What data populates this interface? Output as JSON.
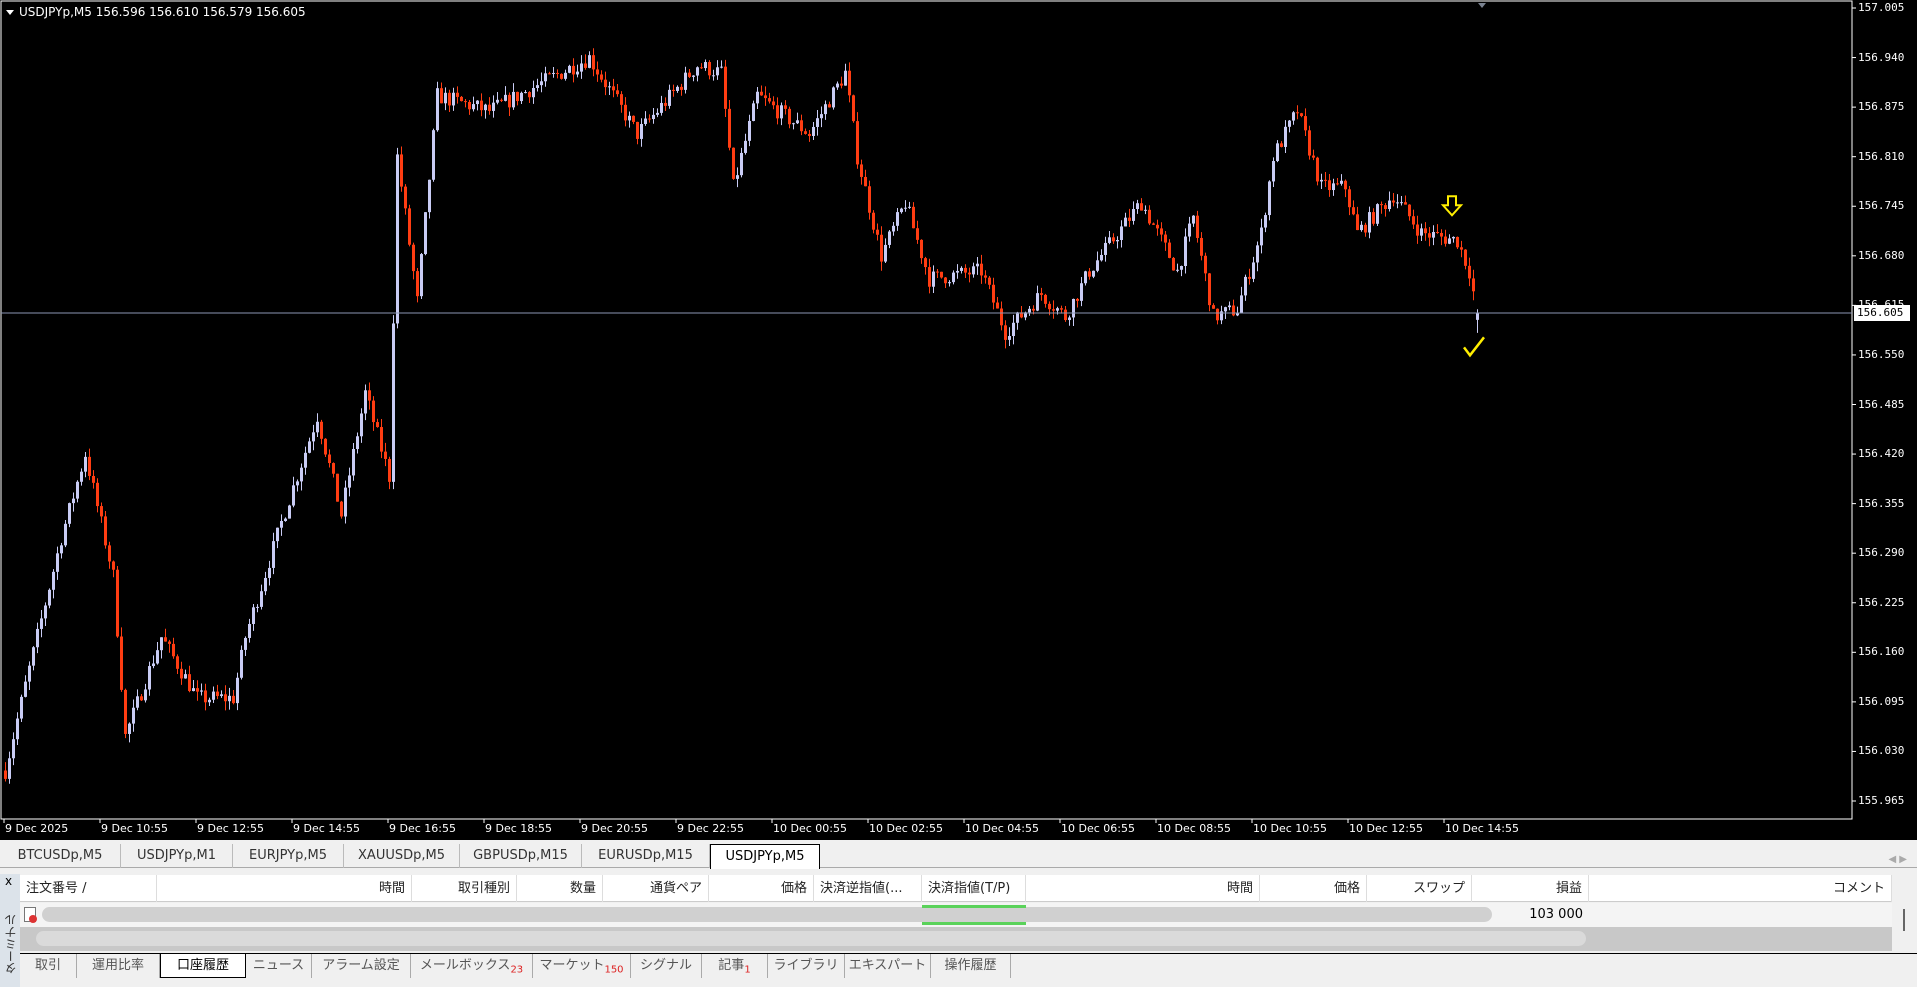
{
  "chart": {
    "symbol_line": "USDJPYp,M5  156.596 156.610 156.579 156.605",
    "bid_label": "156.605",
    "colors": {
      "bull": "#c9ccf5",
      "bear": "#ff3d12",
      "bid_line": "#8c96b4",
      "annotation": "#ffee00"
    }
  },
  "chart_data": {
    "type": "candlestick",
    "timeframe": "M5",
    "y_ticks": [
      "157.005",
      "156.940",
      "156.875",
      "156.810",
      "156.745",
      "156.680",
      "156.615",
      "156.550",
      "156.485",
      "156.420",
      "156.355",
      "156.290",
      "156.225",
      "156.160",
      "156.095",
      "156.030",
      "155.965"
    ],
    "ylim": [
      155.965,
      157.005
    ],
    "x_ticks": [
      "9 Dec 2025",
      "9 Dec 10:55",
      "9 Dec 12:55",
      "9 Dec 14:55",
      "9 Dec 16:55",
      "9 Dec 18:55",
      "9 Dec 20:55",
      "9 Dec 22:55",
      "10 Dec 00:55",
      "10 Dec 02:55",
      "10 Dec 04:55",
      "10 Dec 06:55",
      "10 Dec 08:55",
      "10 Dec 10:55",
      "10 Dec 12:55",
      "10 Dec 14:55"
    ],
    "last": {
      "open": 156.596,
      "high": 156.61,
      "low": 156.579,
      "close": 156.605
    },
    "approx_close_path": [
      [
        "2025-12-09 08:55",
        156.005
      ],
      [
        "2025-12-09 09:20",
        156.117
      ],
      [
        "2025-12-09 10:05",
        156.31
      ],
      [
        "2025-12-09 10:35",
        156.42
      ],
      [
        "2025-12-09 11:10",
        156.26
      ],
      [
        "2025-12-09 11:25",
        156.05
      ],
      [
        "2025-12-09 12:10",
        156.18
      ],
      [
        "2025-12-09 12:55",
        156.1
      ],
      [
        "2025-12-09 13:40",
        156.1
      ],
      [
        "2025-12-09 13:55",
        156.18
      ],
      [
        "2025-12-09 14:40",
        156.33
      ],
      [
        "2025-12-09 15:25",
        156.47
      ],
      [
        "2025-12-09 15:55",
        156.34
      ],
      [
        "2025-12-09 16:25",
        156.5
      ],
      [
        "2025-12-09 16:55",
        156.39
      ],
      [
        "2025-12-09 17:05",
        156.81
      ],
      [
        "2025-12-09 17:30",
        156.62
      ],
      [
        "2025-12-09 17:55",
        156.89
      ],
      [
        "2025-12-09 19:00",
        156.87
      ],
      [
        "2025-12-09 21:05",
        156.94
      ],
      [
        "2025-12-09 22:05",
        156.84
      ],
      [
        "2025-12-09 23:20",
        156.93
      ],
      [
        "2025-12-09 23:50",
        156.92
      ],
      [
        "2025-12-10 00:05",
        156.77
      ],
      [
        "2025-12-10 00:35",
        156.89
      ],
      [
        "2025-12-10 01:40",
        156.84
      ],
      [
        "2025-12-10 02:25",
        156.92
      ],
      [
        "2025-12-10 02:40",
        156.81
      ],
      [
        "2025-12-10 03:10",
        156.68
      ],
      [
        "2025-12-10 03:40",
        156.75
      ],
      [
        "2025-12-10 04:10",
        156.65
      ],
      [
        "2025-12-10 05:15",
        156.66
      ],
      [
        "2025-12-10 05:45",
        156.58
      ],
      [
        "2025-12-10 06:30",
        156.63
      ],
      [
        "2025-12-10 07:00",
        156.6
      ],
      [
        "2025-12-10 07:30",
        156.66
      ],
      [
        "2025-12-10 08:35",
        156.75
      ],
      [
        "2025-12-10 09:20",
        156.66
      ],
      [
        "2025-12-10 09:40",
        156.73
      ],
      [
        "2025-12-10 10:05",
        156.6
      ],
      [
        "2025-12-10 10:35",
        156.61
      ],
      [
        "2025-12-10 11:05",
        156.71
      ],
      [
        "2025-12-10 11:20",
        156.81
      ],
      [
        "2025-12-10 11:50",
        156.87
      ],
      [
        "2025-12-10 12:20",
        156.77
      ],
      [
        "2025-12-10 12:50",
        156.77
      ],
      [
        "2025-12-10 13:05",
        156.71
      ],
      [
        "2025-12-10 13:50",
        156.76
      ],
      [
        "2025-12-10 14:25",
        156.71
      ],
      [
        "2025-12-10 15:10",
        156.7
      ],
      [
        "2025-12-10 15:25",
        156.66
      ],
      [
        "2025-12-10 15:35",
        156.605
      ]
    ],
    "annotations": [
      {
        "type": "down-arrow",
        "time": "2025-12-10 15:05",
        "price": 156.745
      },
      {
        "type": "check-mark",
        "time": "2025-12-10 15:30",
        "price": 156.56
      }
    ]
  },
  "chart_tabs": [
    "BTCUSDp,M5",
    "USDJPYp,M1",
    "EURJPYp,M5",
    "XAUUSDp,M5",
    "GBPUSDp,M15",
    "EURUSDp,M15",
    "USDJPYp,M5"
  ],
  "active_chart_tab": "USDJPYp,M5",
  "terminal": {
    "close": "x",
    "side_label": "ターミナル",
    "columns": [
      "注文番号 /",
      "時間",
      "取引種別",
      "数量",
      "通貨ペア",
      "価格",
      "決済逆指値(...",
      "決済指値(T/P)",
      "時間",
      "価格",
      "スワップ",
      "損益",
      "コメント"
    ],
    "rows": [
      {
        "profit": "103 000"
      }
    ],
    "tabs": [
      {
        "label": "取引"
      },
      {
        "label": "運用比率"
      },
      {
        "label": "口座履歴"
      },
      {
        "label": "ニュース"
      },
      {
        "label": "アラーム設定"
      },
      {
        "label": "メールボックス",
        "badge": "23"
      },
      {
        "label": "マーケット",
        "badge": "150"
      },
      {
        "label": "シグナル"
      },
      {
        "label": "記事",
        "badge": "1"
      },
      {
        "label": "ライブラリ"
      },
      {
        "label": "エキスパート"
      },
      {
        "label": "操作履歴"
      }
    ],
    "active_tab": "口座履歴"
  }
}
